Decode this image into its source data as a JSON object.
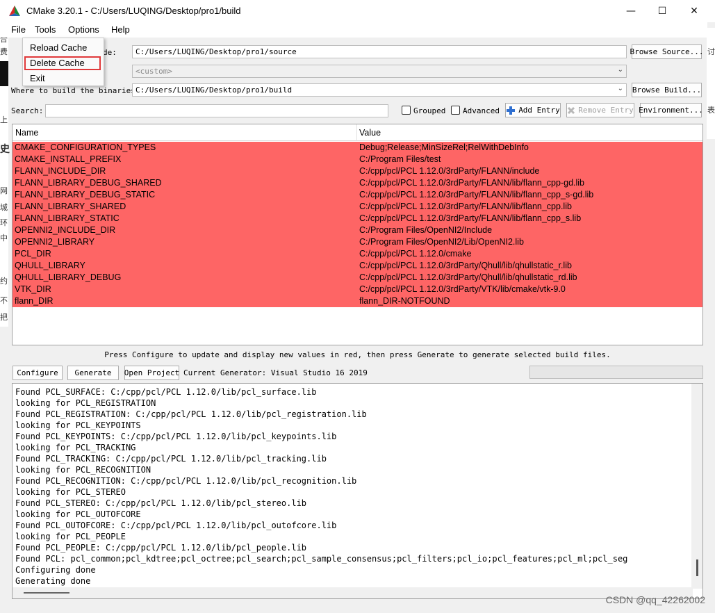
{
  "window": {
    "title": "CMake 3.20.1 - C:/Users/LUQING/Desktop/pro1/build",
    "minimize": "—",
    "maximize": "☐",
    "close": "✕"
  },
  "menubar": {
    "file": "File",
    "tools": "Tools",
    "options": "Options",
    "help": "Help"
  },
  "file_menu": {
    "items": [
      "Reload Cache",
      "Delete Cache",
      "Exit"
    ],
    "highlight_color": "#e0393a"
  },
  "source_row": {
    "label_partial": "de:",
    "value": "C:/Users/LUQING/Desktop/pro1/source",
    "browse_label": "Browse Source..."
  },
  "preset_row": {
    "value": "<custom>"
  },
  "build_row": {
    "label": "Where to build the binaries:",
    "value": "C:/Users/LUQING/Desktop/pro1/build",
    "browse_label": "Browse Build..."
  },
  "search_row": {
    "label": "Search:",
    "value": "",
    "grouped_label": "Grouped",
    "advanced_label": "Advanced",
    "add_entry_label": "Add Entry",
    "remove_entry_label": "Remove Entry",
    "environment_label": "Environment..."
  },
  "cache_table": {
    "columns": [
      "Name",
      "Value"
    ],
    "row_color": "#fe6565",
    "rows": [
      {
        "name": "CMAKE_CONFIGURATION_TYPES",
        "value": "Debug;Release;MinSizeRel;RelWithDebInfo"
      },
      {
        "name": "CMAKE_INSTALL_PREFIX",
        "value": "C:/Program Files/test"
      },
      {
        "name": "FLANN_INCLUDE_DIR",
        "value": "C:/cpp/pcl/PCL 1.12.0/3rdParty/FLANN/include"
      },
      {
        "name": "FLANN_LIBRARY_DEBUG_SHARED",
        "value": "C:/cpp/pcl/PCL 1.12.0/3rdParty/FLANN/lib/flann_cpp-gd.lib"
      },
      {
        "name": "FLANN_LIBRARY_DEBUG_STATIC",
        "value": "C:/cpp/pcl/PCL 1.12.0/3rdParty/FLANN/lib/flann_cpp_s-gd.lib"
      },
      {
        "name": "FLANN_LIBRARY_SHARED",
        "value": "C:/cpp/pcl/PCL 1.12.0/3rdParty/FLANN/lib/flann_cpp.lib"
      },
      {
        "name": "FLANN_LIBRARY_STATIC",
        "value": "C:/cpp/pcl/PCL 1.12.0/3rdParty/FLANN/lib/flann_cpp_s.lib"
      },
      {
        "name": "OPENNI2_INCLUDE_DIR",
        "value": "C:/Program Files/OpenNI2/Include"
      },
      {
        "name": "OPENNI2_LIBRARY",
        "value": "C:/Program Files/OpenNI2/Lib/OpenNI2.lib"
      },
      {
        "name": "PCL_DIR",
        "value": "C:/cpp/pcl/PCL 1.12.0/cmake"
      },
      {
        "name": "QHULL_LIBRARY",
        "value": "C:/cpp/pcl/PCL 1.12.0/3rdParty/Qhull/lib/qhullstatic_r.lib"
      },
      {
        "name": "QHULL_LIBRARY_DEBUG",
        "value": "C:/cpp/pcl/PCL 1.12.0/3rdParty/Qhull/lib/qhullstatic_rd.lib"
      },
      {
        "name": "VTK_DIR",
        "value": "C:/cpp/pcl/PCL 1.12.0/3rdParty/VTK/lib/cmake/vtk-9.0"
      },
      {
        "name": "flann_DIR",
        "value": "flann_DIR-NOTFOUND"
      }
    ]
  },
  "hint": "Press Configure to update and display new values in red, then press Generate to generate selected build files.",
  "controls": {
    "configure_label": "Configure",
    "generate_label": "Generate",
    "open_project_label": "Open Project",
    "current_generator": "Current Generator: Visual Studio 16 2019"
  },
  "output_log": [
    "Found PCL_SURFACE: C:/cpp/pcl/PCL 1.12.0/lib/pcl_surface.lib",
    "looking for PCL_REGISTRATION",
    "Found PCL_REGISTRATION: C:/cpp/pcl/PCL 1.12.0/lib/pcl_registration.lib",
    "looking for PCL_KEYPOINTS",
    "Found PCL_KEYPOINTS: C:/cpp/pcl/PCL 1.12.0/lib/pcl_keypoints.lib",
    "looking for PCL_TRACKING",
    "Found PCL_TRACKING: C:/cpp/pcl/PCL 1.12.0/lib/pcl_tracking.lib",
    "looking for PCL_RECOGNITION",
    "Found PCL_RECOGNITION: C:/cpp/pcl/PCL 1.12.0/lib/pcl_recognition.lib",
    "looking for PCL_STEREO",
    "Found PCL_STEREO: C:/cpp/pcl/PCL 1.12.0/lib/pcl_stereo.lib",
    "looking for PCL_OUTOFCORE",
    "Found PCL_OUTOFCORE: C:/cpp/pcl/PCL 1.12.0/lib/pcl_outofcore.lib",
    "looking for PCL_PEOPLE",
    "Found PCL_PEOPLE: C:/cpp/pcl/PCL 1.12.0/lib/pcl_people.lib",
    "Found PCL: pcl_common;pcl_kdtree;pcl_octree;pcl_search;pcl_sample_consensus;pcl_filters;pcl_io;pcl_features;pcl_ml;pcl_seg",
    "Configuring done",
    "Generating done"
  ],
  "background": {
    "left_glyphs": [
      "合",
      "费",
      "上",
      "史",
      "网",
      "城",
      "环",
      "中",
      "约",
      "不",
      "把"
    ],
    "right_glyphs": [
      "讨",
      "表"
    ]
  },
  "watermark": "CSDN @qq_42262002"
}
